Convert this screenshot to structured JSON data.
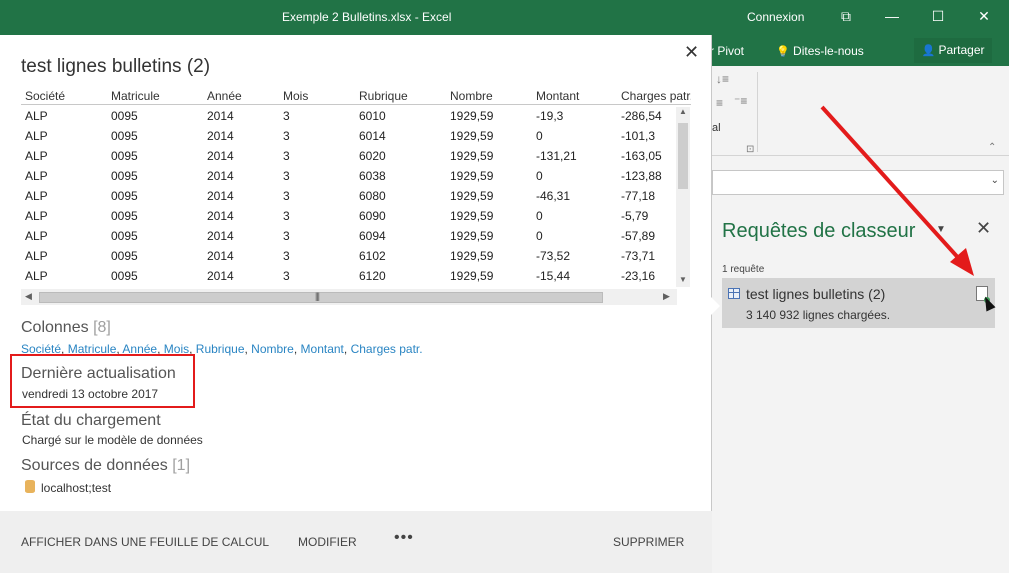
{
  "window": {
    "title": "Exemple 2 Bulletins.xlsx  -  Excel",
    "connexion": "Connexion",
    "restore_icon": "⧉",
    "minimize_icon": "—",
    "maximize_icon": "☐",
    "close_icon": "✕"
  },
  "ribbon": {
    "pivot_label": "r Pivot",
    "tell_label": "Dites-le-nous",
    "tell_icon": "💡",
    "share_label": "Partager",
    "share_icon": "👤",
    "group_label": "al",
    "launcher_icon": "⊡",
    "collapse_icon": "⌃",
    "formula_caret": "⌄"
  },
  "queries_pane": {
    "title": "Requêtes de classeur",
    "dropdown_icon": "▼",
    "close_icon": "✕",
    "count": "1 requête",
    "item_name": "test lignes bulletins (2)",
    "item_status": "3 140 932 lignes chargées."
  },
  "card": {
    "title": "test lignes bulletins (2)",
    "close_icon": "✕",
    "headers": [
      "Société",
      "Matricule",
      "Année",
      "Mois",
      "Rubrique",
      "Nombre",
      "Montant",
      "Charges patr."
    ],
    "rows": [
      [
        "ALP",
        "0095",
        "2014",
        "3",
        "6010",
        "1929,59",
        "-19,3",
        "-286,54"
      ],
      [
        "ALP",
        "0095",
        "2014",
        "3",
        "6014",
        "1929,59",
        "0",
        "-101,3"
      ],
      [
        "ALP",
        "0095",
        "2014",
        "3",
        "6020",
        "1929,59",
        "-131,21",
        "-163,05"
      ],
      [
        "ALP",
        "0095",
        "2014",
        "3",
        "6038",
        "1929,59",
        "0",
        "-123,88"
      ],
      [
        "ALP",
        "0095",
        "2014",
        "3",
        "6080",
        "1929,59",
        "-46,31",
        "-77,18"
      ],
      [
        "ALP",
        "0095",
        "2014",
        "3",
        "6090",
        "1929,59",
        "0",
        "-5,79"
      ],
      [
        "ALP",
        "0095",
        "2014",
        "3",
        "6094",
        "1929,59",
        "0",
        "-57,89"
      ],
      [
        "ALP",
        "0095",
        "2014",
        "3",
        "6102",
        "1929,59",
        "-73,52",
        "-73,71"
      ],
      [
        "ALP",
        "0095",
        "2014",
        "3",
        "6120",
        "1929,59",
        "-15,44",
        "-23,16"
      ]
    ],
    "colonnes": {
      "title": "Colonnes",
      "count": "[8]",
      "links": [
        "Société",
        "Matricule",
        "Année",
        "Mois",
        "Rubrique",
        "Nombre",
        "Montant",
        "Charges patr."
      ]
    },
    "derniere": {
      "title": "Dernière actualisation",
      "value": "vendredi 13 octobre 2017"
    },
    "etat": {
      "title": "État du chargement",
      "value": "Chargé sur le modèle de données"
    },
    "sources": {
      "title": "Sources de données",
      "count": "[1]",
      "value": "localhost;test"
    },
    "footer": {
      "afficher": "AFFICHER DANS UNE FEUILLE DE CALCUL",
      "modifier": "MODIFIER",
      "more": "•••",
      "supprimer": "SUPPRIMER"
    }
  },
  "colors": {
    "excel_green": "#217346",
    "link_blue": "#2a85c3",
    "annotation_red": "#e31b1b"
  }
}
